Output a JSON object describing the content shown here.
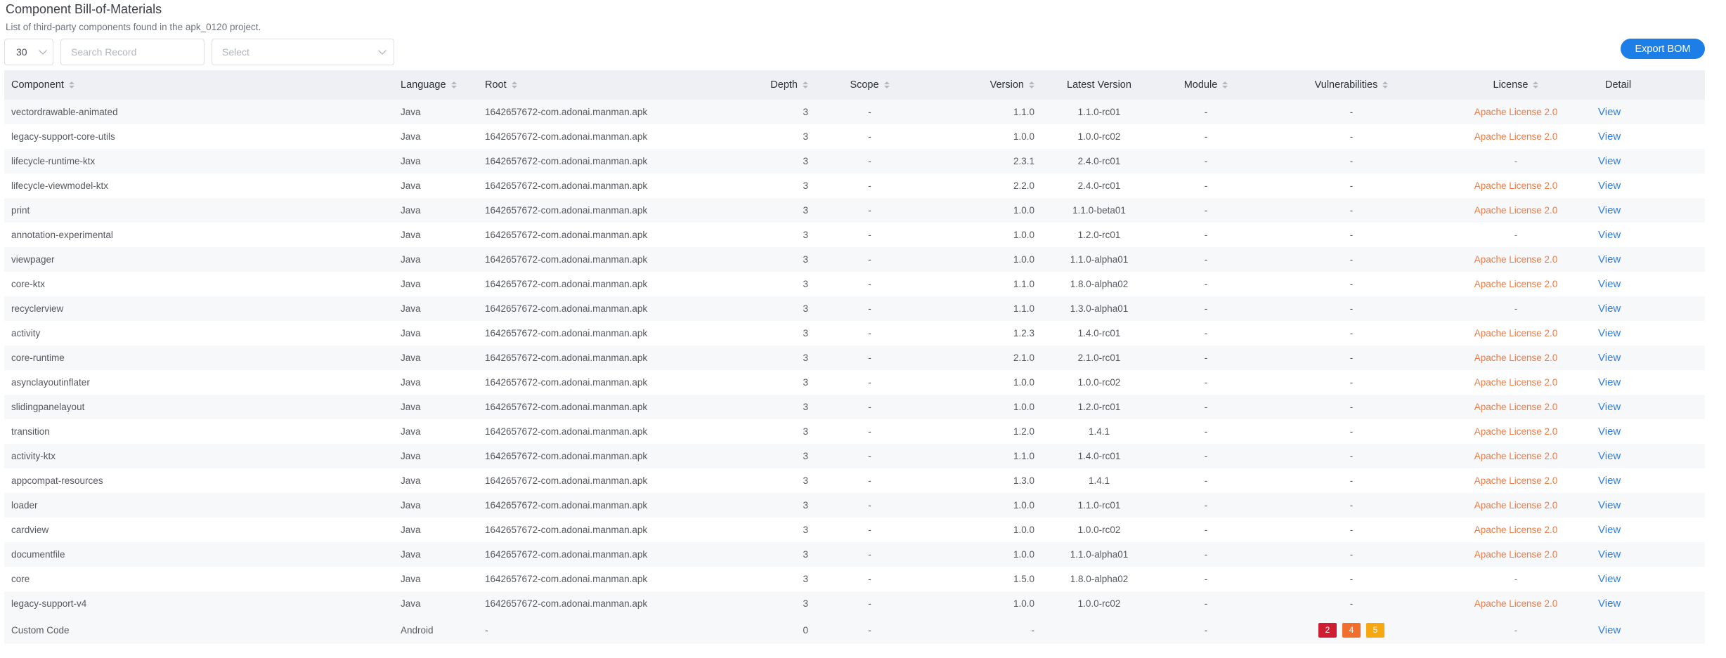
{
  "header": {
    "title": "Component Bill-of-Materials",
    "subtitle": "List of third-party components found in the apk_0120 project."
  },
  "controls": {
    "page_size": "30",
    "search_placeholder": "Search Record",
    "select_placeholder": "Select",
    "export_label": "Export BOM"
  },
  "table": {
    "columns": [
      "Component",
      "Language",
      "Root",
      "Depth",
      "Scope",
      "Version",
      "Latest Version",
      "Module",
      "Vulnerabilities",
      "License",
      "Detail"
    ],
    "detail_label": "View",
    "rows": [
      {
        "component": "vectordrawable-animated",
        "language": "Java",
        "root": "1642657672-com.adonai.manman.apk",
        "depth": "3",
        "scope": "-",
        "version": "1.1.0",
        "latest": "1.1.0-rc01",
        "module": "-",
        "vulns": "-",
        "license": "Apache License 2.0"
      },
      {
        "component": "legacy-support-core-utils",
        "language": "Java",
        "root": "1642657672-com.adonai.manman.apk",
        "depth": "3",
        "scope": "-",
        "version": "1.0.0",
        "latest": "1.0.0-rc02",
        "module": "-",
        "vulns": "-",
        "license": "Apache License 2.0"
      },
      {
        "component": "lifecycle-runtime-ktx",
        "language": "Java",
        "root": "1642657672-com.adonai.manman.apk",
        "depth": "3",
        "scope": "-",
        "version": "2.3.1",
        "latest": "2.4.0-rc01",
        "module": "-",
        "vulns": "-",
        "license": "-"
      },
      {
        "component": "lifecycle-viewmodel-ktx",
        "language": "Java",
        "root": "1642657672-com.adonai.manman.apk",
        "depth": "3",
        "scope": "-",
        "version": "2.2.0",
        "latest": "2.4.0-rc01",
        "module": "-",
        "vulns": "-",
        "license": "Apache License 2.0"
      },
      {
        "component": "print",
        "language": "Java",
        "root": "1642657672-com.adonai.manman.apk",
        "depth": "3",
        "scope": "-",
        "version": "1.0.0",
        "latest": "1.1.0-beta01",
        "module": "-",
        "vulns": "-",
        "license": "Apache License 2.0"
      },
      {
        "component": "annotation-experimental",
        "language": "Java",
        "root": "1642657672-com.adonai.manman.apk",
        "depth": "3",
        "scope": "-",
        "version": "1.0.0",
        "latest": "1.2.0-rc01",
        "module": "-",
        "vulns": "-",
        "license": "-"
      },
      {
        "component": "viewpager",
        "language": "Java",
        "root": "1642657672-com.adonai.manman.apk",
        "depth": "3",
        "scope": "-",
        "version": "1.0.0",
        "latest": "1.1.0-alpha01",
        "module": "-",
        "vulns": "-",
        "license": "Apache License 2.0"
      },
      {
        "component": "core-ktx",
        "language": "Java",
        "root": "1642657672-com.adonai.manman.apk",
        "depth": "3",
        "scope": "-",
        "version": "1.1.0",
        "latest": "1.8.0-alpha02",
        "module": "-",
        "vulns": "-",
        "license": "Apache License 2.0"
      },
      {
        "component": "recyclerview",
        "language": "Java",
        "root": "1642657672-com.adonai.manman.apk",
        "depth": "3",
        "scope": "-",
        "version": "1.1.0",
        "latest": "1.3.0-alpha01",
        "module": "-",
        "vulns": "-",
        "license": "-"
      },
      {
        "component": "activity",
        "language": "Java",
        "root": "1642657672-com.adonai.manman.apk",
        "depth": "3",
        "scope": "-",
        "version": "1.2.3",
        "latest": "1.4.0-rc01",
        "module": "-",
        "vulns": "-",
        "license": "Apache License 2.0"
      },
      {
        "component": "core-runtime",
        "language": "Java",
        "root": "1642657672-com.adonai.manman.apk",
        "depth": "3",
        "scope": "-",
        "version": "2.1.0",
        "latest": "2.1.0-rc01",
        "module": "-",
        "vulns": "-",
        "license": "Apache License 2.0"
      },
      {
        "component": "asynclayoutinflater",
        "language": "Java",
        "root": "1642657672-com.adonai.manman.apk",
        "depth": "3",
        "scope": "-",
        "version": "1.0.0",
        "latest": "1.0.0-rc02",
        "module": "-",
        "vulns": "-",
        "license": "Apache License 2.0"
      },
      {
        "component": "slidingpanelayout",
        "language": "Java",
        "root": "1642657672-com.adonai.manman.apk",
        "depth": "3",
        "scope": "-",
        "version": "1.0.0",
        "latest": "1.2.0-rc01",
        "module": "-",
        "vulns": "-",
        "license": "Apache License 2.0"
      },
      {
        "component": "transition",
        "language": "Java",
        "root": "1642657672-com.adonai.manman.apk",
        "depth": "3",
        "scope": "-",
        "version": "1.2.0",
        "latest": "1.4.1",
        "module": "-",
        "vulns": "-",
        "license": "Apache License 2.0"
      },
      {
        "component": "activity-ktx",
        "language": "Java",
        "root": "1642657672-com.adonai.manman.apk",
        "depth": "3",
        "scope": "-",
        "version": "1.1.0",
        "latest": "1.4.0-rc01",
        "module": "-",
        "vulns": "-",
        "license": "Apache License 2.0"
      },
      {
        "component": "appcompat-resources",
        "language": "Java",
        "root": "1642657672-com.adonai.manman.apk",
        "depth": "3",
        "scope": "-",
        "version": "1.3.0",
        "latest": "1.4.1",
        "module": "-",
        "vulns": "-",
        "license": "Apache License 2.0"
      },
      {
        "component": "loader",
        "language": "Java",
        "root": "1642657672-com.adonai.manman.apk",
        "depth": "3",
        "scope": "-",
        "version": "1.0.0",
        "latest": "1.1.0-rc01",
        "module": "-",
        "vulns": "-",
        "license": "Apache License 2.0"
      },
      {
        "component": "cardview",
        "language": "Java",
        "root": "1642657672-com.adonai.manman.apk",
        "depth": "3",
        "scope": "-",
        "version": "1.0.0",
        "latest": "1.0.0-rc02",
        "module": "-",
        "vulns": "-",
        "license": "Apache License 2.0"
      },
      {
        "component": "documentfile",
        "language": "Java",
        "root": "1642657672-com.adonai.manman.apk",
        "depth": "3",
        "scope": "-",
        "version": "1.0.0",
        "latest": "1.1.0-alpha01",
        "module": "-",
        "vulns": "-",
        "license": "Apache License 2.0"
      },
      {
        "component": "core",
        "language": "Java",
        "root": "1642657672-com.adonai.manman.apk",
        "depth": "3",
        "scope": "-",
        "version": "1.5.0",
        "latest": "1.8.0-alpha02",
        "module": "-",
        "vulns": "-",
        "license": "-"
      },
      {
        "component": "legacy-support-v4",
        "language": "Java",
        "root": "1642657672-com.adonai.manman.apk",
        "depth": "3",
        "scope": "-",
        "version": "1.0.0",
        "latest": "1.0.0-rc02",
        "module": "-",
        "vulns": "-",
        "license": "Apache License 2.0"
      }
    ],
    "custom_row": {
      "component": "Custom Code",
      "language": "Android",
      "root": "-",
      "depth": "0",
      "scope": "-",
      "version": "-",
      "latest": "",
      "module": "-",
      "license": "-",
      "vuln_counts": [
        {
          "count": "2",
          "severity": "critical",
          "color": "#cf1e31"
        },
        {
          "count": "4",
          "severity": "high",
          "color": "#f06f2d"
        },
        {
          "count": "5",
          "severity": "medium",
          "color": "#f7a710"
        }
      ]
    }
  },
  "colors": {
    "accent": "#1e7ee8",
    "link": "#2f7ee0",
    "license": "#ee7a44",
    "header_bg": "#eef0f4"
  }
}
